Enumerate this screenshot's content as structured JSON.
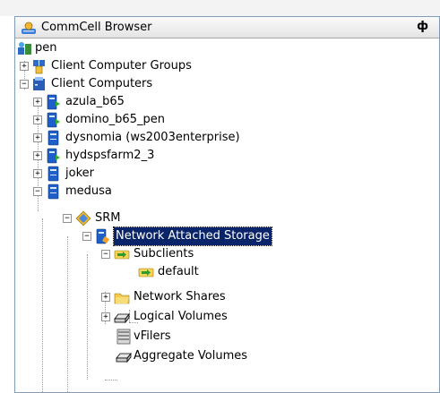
{
  "panel": {
    "title": "CommCell Browser",
    "pin_glyph": "ᴩ"
  },
  "tree": {
    "root": "pen",
    "client_computer_groups": "Client Computer Groups",
    "client_computers": "Client Computers",
    "clients": [
      "azula_b65",
      "domino_b65_pen",
      "dysnomia (ws2003enterprise)",
      "hydspsfarm2_3",
      "joker",
      "medusa"
    ],
    "srm": "SRM",
    "nas": "Network Attached Storage",
    "subclients": "Subclients",
    "default": "default",
    "network_shares": "Network Shares",
    "logical_volumes": "Logical Volumes",
    "vfilers": "vFilers",
    "aggregate_volumes": "Aggregate Volumes"
  },
  "expanders": {
    "plus": "+",
    "minus": "−"
  },
  "icons": {
    "commcell": "commcell-browser-icon",
    "root": "commcell-root-icon",
    "group": "client-group-icon",
    "computers": "client-computers-icon",
    "client_green": "client-online-icon",
    "client_blue": "client-icon",
    "srm": "srm-diamond-icon",
    "nas": "nas-server-icon",
    "subclient": "subclient-arrow-icon",
    "folder": "network-share-folder-icon",
    "disk": "logical-volume-disk-icon",
    "server": "vfiler-server-icon"
  },
  "colors": {
    "selection": "#0a246a",
    "border": "#7f9db9"
  }
}
